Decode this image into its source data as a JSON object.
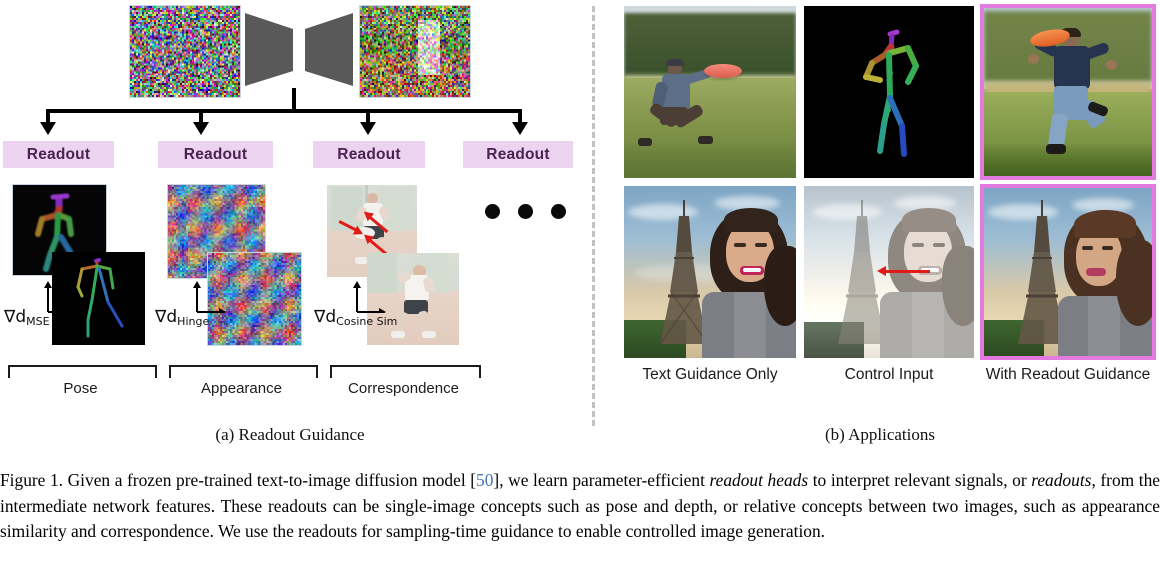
{
  "figure": {
    "number": "Figure 1.",
    "caption_parts": [
      {
        "t": "Figure 1. Given a frozen pre-trained text-to-image diffusion model [",
        "style": "normal"
      },
      {
        "t": "50",
        "style": "cite"
      },
      {
        "t": "], we learn parameter-efficient ",
        "style": "normal"
      },
      {
        "t": "readout heads",
        "style": "italic"
      },
      {
        "t": " to interpret relevant signals, or ",
        "style": "normal"
      },
      {
        "t": "readouts",
        "style": "italic"
      },
      {
        "t": ", from the intermediate network features. These readouts can be single-image concepts such as pose and depth, or relative concepts between two images, such as appearance similarity and correspondence. We use the readouts for sampling-time guidance to enable controlled image generation.",
        "style": "normal"
      }
    ],
    "citation_number": "50"
  },
  "panel_a": {
    "caption": "(a) Readout Guidance",
    "diffusion": {
      "input_name": "noise-latent-image",
      "output_name": "denoised-frisbee-image",
      "unet_name": "unet-hourglass",
      "unet_color": "#595959"
    },
    "readout_label": "Readout",
    "readout_bg": "#ecd4f0",
    "readout_fg": "#4a2350",
    "heads": [
      {
        "id": "pose",
        "label": "Readout",
        "gradient_main": "∇d",
        "gradient_sub": "MSE"
      },
      {
        "id": "appearance",
        "label": "Readout",
        "gradient_main": "∇d",
        "gradient_sub": "Hinge"
      },
      {
        "id": "correspondence",
        "label": "Readout",
        "gradient_main": "∇d",
        "gradient_sub": "Cosine Sim"
      },
      {
        "id": "more",
        "label": "Readout",
        "gradient_main": "",
        "gradient_sub": ""
      }
    ],
    "groups": [
      {
        "id": "pose",
        "label": "Pose"
      },
      {
        "id": "appearance",
        "label": "Appearance"
      },
      {
        "id": "correspondence",
        "label": "Correspondence"
      }
    ],
    "ellipsis_dots": 3
  },
  "panel_b": {
    "caption": "(b) Applications",
    "columns": [
      {
        "id": "text-guidance-only",
        "label": "Text Guidance Only",
        "highlighted": false
      },
      {
        "id": "control-input",
        "label": "Control Input",
        "highlighted": false
      },
      {
        "id": "with-readout-guidance",
        "label": "With Readout Guidance",
        "highlighted": true
      }
    ],
    "rows": [
      {
        "id": "pose-row",
        "images": [
          "frisbee-man-photo",
          "pose-skeleton-map",
          "generated-jumping-man"
        ]
      },
      {
        "id": "drag-row",
        "images": [
          "woman-eiffel-photo",
          "drag-control-input",
          "generated-woman-turned"
        ]
      }
    ],
    "highlight_color": "#e27ae0"
  }
}
